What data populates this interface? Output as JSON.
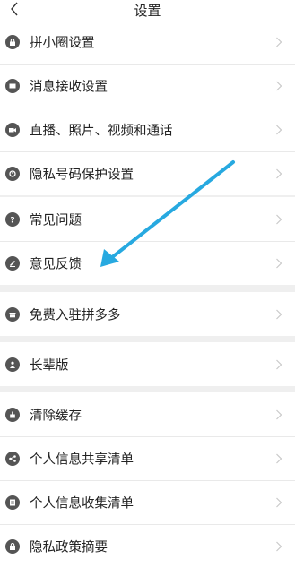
{
  "header": {
    "title": "设置"
  },
  "groups": [
    {
      "items": [
        {
          "label": "拼小圈设置",
          "icon": "lock-icon"
        },
        {
          "label": "消息接收设置",
          "icon": "message-icon"
        },
        {
          "label": "直播、照片、视频和通话",
          "icon": "video-icon"
        },
        {
          "label": "隐私号码保护设置",
          "icon": "privacy-icon"
        }
      ]
    },
    {
      "items": [
        {
          "label": "常见问题",
          "icon": "question-icon"
        },
        {
          "label": "意见反馈",
          "icon": "edit-icon"
        }
      ]
    },
    {
      "items": [
        {
          "label": "免费入驻拼多多",
          "icon": "store-icon"
        }
      ]
    },
    {
      "items": [
        {
          "label": "长辈版",
          "icon": "elder-icon"
        }
      ]
    },
    {
      "items": [
        {
          "label": "清除缓存",
          "icon": "broom-icon"
        },
        {
          "label": "个人信息共享清单",
          "icon": "share-icon"
        },
        {
          "label": "个人信息收集清单",
          "icon": "list-icon"
        },
        {
          "label": "隐私政策摘要",
          "icon": "lock-icon"
        }
      ]
    }
  ],
  "colors": {
    "arrow": "#27a9e0",
    "icon": "#555555",
    "chevron": "#c9c9c9",
    "background": "#efefef"
  }
}
